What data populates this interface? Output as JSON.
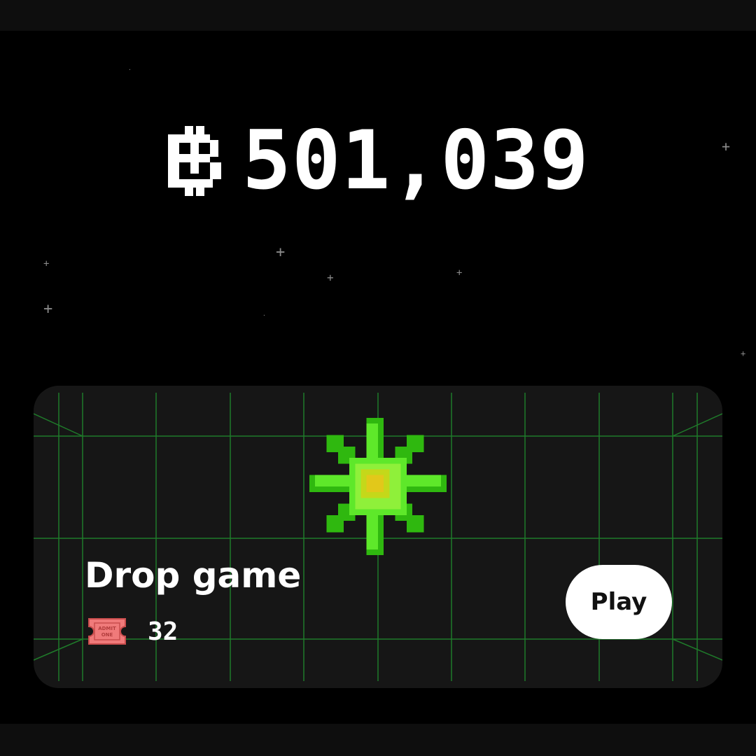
{
  "balance": {
    "currency_icon": "pixel-coin-icon",
    "value": "501,039"
  },
  "game_card": {
    "title": "Drop game",
    "art_icon": "green-gem-icon",
    "ticket_icon": "admit-one-ticket-icon",
    "ticket_text": "ADMIT ONE",
    "ticket_count": "32",
    "play_label": "Play"
  },
  "colors": {
    "background": "#000000",
    "card": "#161616",
    "grid": "#1f7a2a",
    "gem": "#49e01a",
    "ticket": "#f07a7a"
  }
}
